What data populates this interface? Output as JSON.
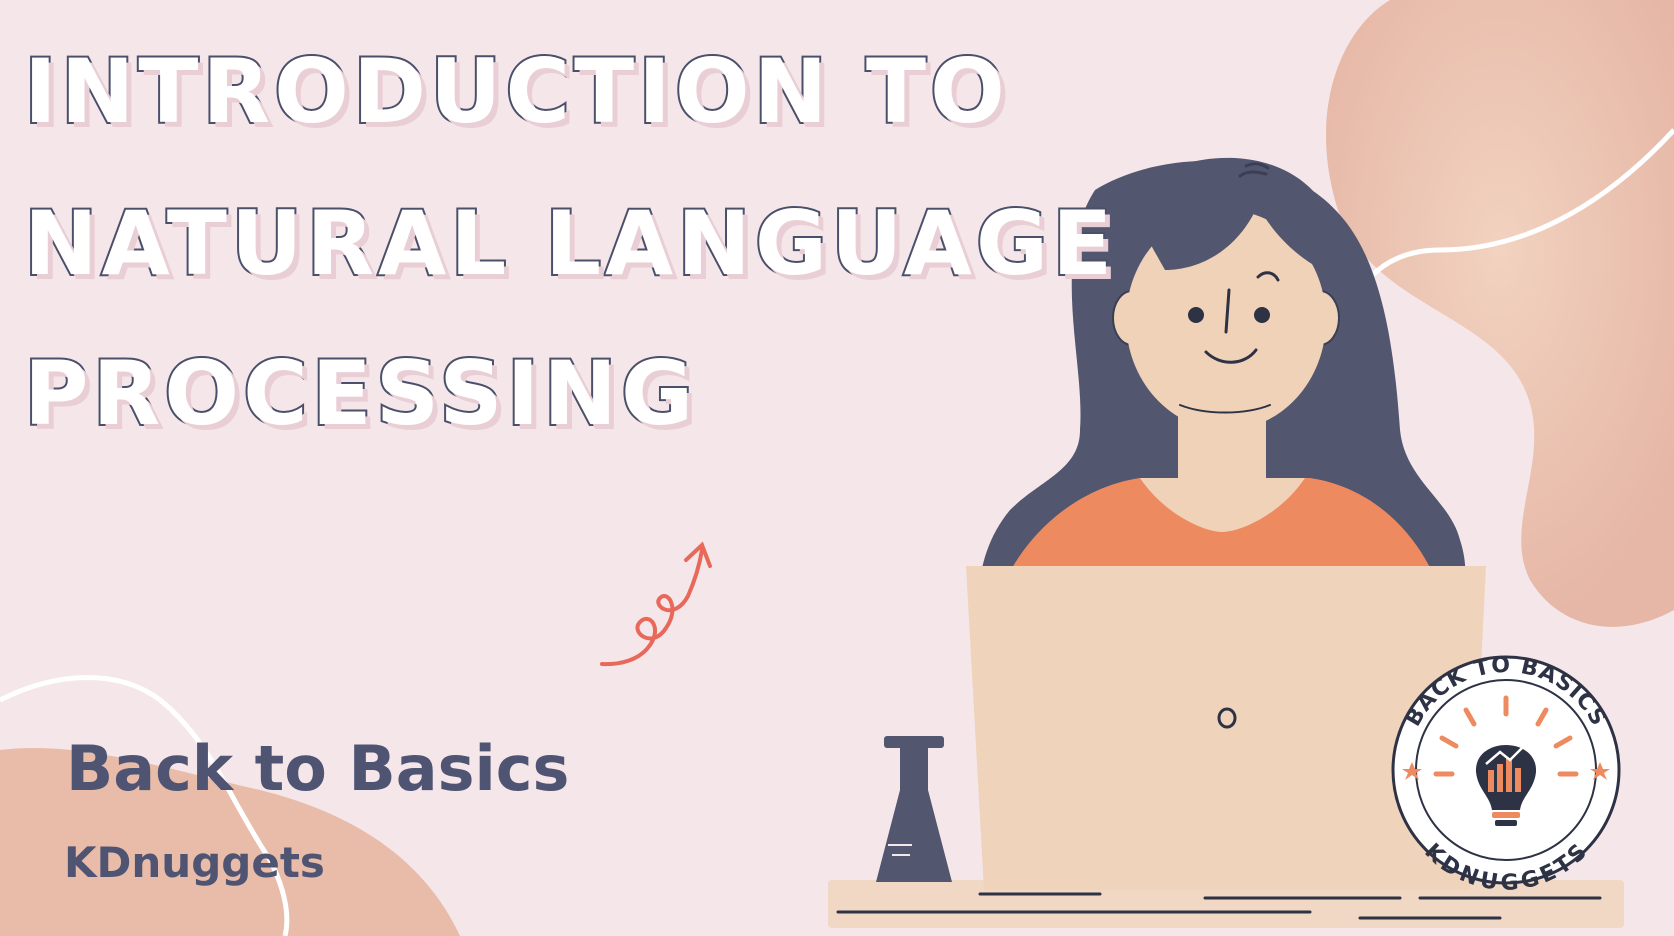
{
  "title": {
    "line1": "INTRODUCTION TO",
    "line2": "NATURAL LANGUAGE",
    "line3": "PROCESSING"
  },
  "subtitle": "Back to Basics",
  "brand": "KDnuggets",
  "badge": {
    "top_text": "BACK TO BASICS",
    "bottom_text": "KDNUGGETS"
  },
  "colors": {
    "background": "#f5e6ea",
    "blob": "#e8bca8",
    "hair": "#52566f",
    "skin": "#f0d2b8",
    "shirt": "#ee8a60",
    "laptop": "#efd3bb",
    "desk": "#f0d8c4",
    "text_dark": "#4f5473",
    "arrow": "#e8685a"
  },
  "icons": [
    "swirl-arrow-icon",
    "lightbulb-chart-icon",
    "star-icon",
    "flask-icon",
    "laptop-logo-icon"
  ]
}
